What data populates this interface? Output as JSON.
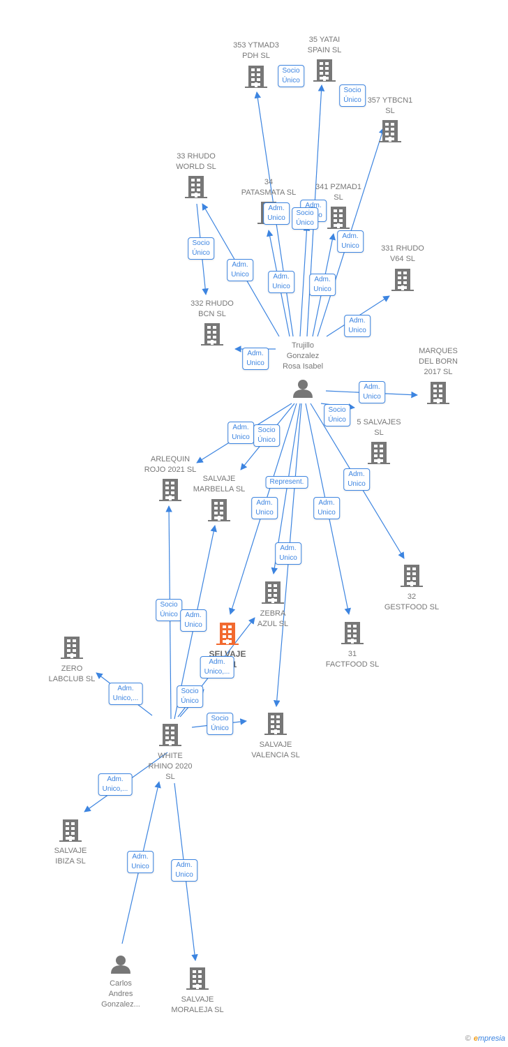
{
  "colors": {
    "edge": "#3c84e0",
    "node": "#777777",
    "highlight": "#f26a30"
  },
  "nodes": [
    {
      "id": "n353",
      "type": "company",
      "label": [
        "353 YTMAD3",
        "PDH  SL"
      ]
    },
    {
      "id": "n35",
      "type": "company",
      "label": [
        "35 YATAI",
        "SPAIN  SL"
      ]
    },
    {
      "id": "n357",
      "type": "company",
      "label": [
        "357 YTBCN1",
        "SL"
      ]
    },
    {
      "id": "n33",
      "type": "company",
      "label": [
        "33 RHUDO",
        "WORLD  SL"
      ]
    },
    {
      "id": "n34",
      "type": "company",
      "label": [
        "34",
        "PATASMATA  SL"
      ]
    },
    {
      "id": "n341",
      "type": "company",
      "label": [
        "341 PZMAD1",
        "SL"
      ]
    },
    {
      "id": "n331",
      "type": "company",
      "label": [
        "331 RHUDO",
        "V64  SL"
      ]
    },
    {
      "id": "n332",
      "type": "company",
      "label": [
        "332 RHUDO",
        "BCN  SL"
      ]
    },
    {
      "id": "trujillo",
      "type": "person",
      "label": [
        "Trujillo",
        "Gonzalez",
        "Rosa Isabel"
      ]
    },
    {
      "id": "marques",
      "type": "company",
      "label": [
        "MARQUES",
        "DEL BORN",
        "2017  SL"
      ]
    },
    {
      "id": "salvajes5",
      "type": "company",
      "label": [
        "5 SALVAJES",
        "SL"
      ]
    },
    {
      "id": "arlequin",
      "type": "company",
      "label": [
        "ARLEQUIN",
        "ROJO 2021  SL"
      ]
    },
    {
      "id": "marbella",
      "type": "company",
      "label": [
        "SALVAJE",
        "MARBELLA  SL"
      ]
    },
    {
      "id": "gestfood",
      "type": "company",
      "label": [
        "32",
        "GESTFOOD  SL"
      ]
    },
    {
      "id": "zebra",
      "type": "company",
      "label": [
        "ZEBRA",
        "AZUL  SL"
      ]
    },
    {
      "id": "selvaje",
      "type": "company",
      "highlight": true,
      "label": [
        "SELVAJE",
        "2021"
      ]
    },
    {
      "id": "factfood",
      "type": "company",
      "label": [
        "31",
        "FACTFOOD  SL"
      ]
    },
    {
      "id": "zero",
      "type": "company",
      "label": [
        "ZERO",
        "LABCLUB  SL"
      ]
    },
    {
      "id": "valencia",
      "type": "company",
      "label": [
        "SALVAJE",
        "VALENCIA  SL"
      ]
    },
    {
      "id": "whiterhino",
      "type": "company",
      "label": [
        "WHITE",
        "RHINO 2020",
        "SL"
      ]
    },
    {
      "id": "ibiza",
      "type": "company",
      "label": [
        "SALVAJE",
        "IBIZA  SL"
      ]
    },
    {
      "id": "carlos",
      "type": "person",
      "label": [
        "Carlos",
        "Andres",
        "Gonzalez..."
      ]
    },
    {
      "id": "moraleja",
      "type": "company",
      "label": [
        "SALVAJE",
        "MORALEJA  SL"
      ]
    }
  ],
  "edge_labels": [
    [
      "Socio",
      "Único"
    ],
    [
      "Socio",
      "Único"
    ],
    [
      "Socio",
      "Único"
    ],
    [
      "Adm.",
      "Unico"
    ],
    [
      "Adm.",
      "Unico"
    ],
    [
      "Adm.",
      "Unico"
    ],
    [
      "Socio",
      "Único"
    ],
    [
      "Adm.",
      "Unico"
    ],
    [
      "Adm.",
      "Unico"
    ],
    [
      "Adm.",
      "Unico"
    ],
    [
      "Adm.",
      "Unico"
    ],
    [
      "Adm.",
      "Unico"
    ],
    [
      "Adm.",
      "Unico"
    ],
    [
      "Socio",
      "Único"
    ],
    [
      "Adm.",
      "Unico"
    ],
    [
      "Socio",
      "Único"
    ],
    [
      "Represent."
    ],
    [
      "Adm.",
      "Unico"
    ],
    [
      "Adm.",
      "Unico"
    ],
    [
      "Adm.",
      "Unico"
    ],
    [
      "Adm.",
      "Unico"
    ],
    [
      "Socio",
      "Único"
    ],
    [
      "Adm.",
      "Unico"
    ],
    [
      "Adm.",
      "Unico,..."
    ],
    [
      "Adm.",
      "Unico,..."
    ],
    [
      "Socio",
      "Único"
    ],
    [
      "Socio",
      "Único"
    ],
    [
      "Adm.",
      "Unico,..."
    ],
    [
      "Adm.",
      "Unico"
    ],
    [
      "Adm.",
      "Unico"
    ]
  ],
  "footer": {
    "copyright": "©",
    "brand": "empresia"
  }
}
